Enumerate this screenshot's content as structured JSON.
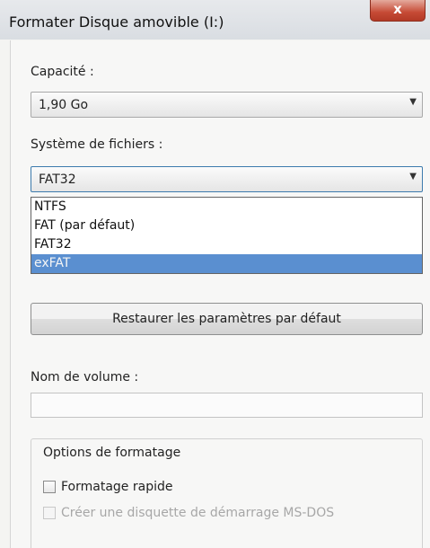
{
  "window": {
    "title": "Formater Disque amovible (I:)",
    "close_label": "x"
  },
  "capacity": {
    "label": "Capacité :",
    "value": "1,90 Go"
  },
  "filesystem": {
    "label": "Système de fichiers :",
    "value": "FAT32",
    "options": [
      "NTFS",
      "FAT (par défaut)",
      "FAT32",
      "exFAT"
    ],
    "highlighted_option": "exFAT"
  },
  "restore_button": {
    "label": "Restaurer les paramètres par défaut"
  },
  "volume_name": {
    "label": "Nom de volume :",
    "value": ""
  },
  "format_options": {
    "title": "Options de formatage",
    "quick_format": {
      "label": "Formatage rapide",
      "checked": false,
      "enabled": true
    },
    "msdos_boot": {
      "label": "Créer une disquette de démarrage MS-DOS",
      "checked": false,
      "enabled": false
    }
  },
  "colors": {
    "selection": "#5a8fd0",
    "close_button": "#c64a35"
  }
}
